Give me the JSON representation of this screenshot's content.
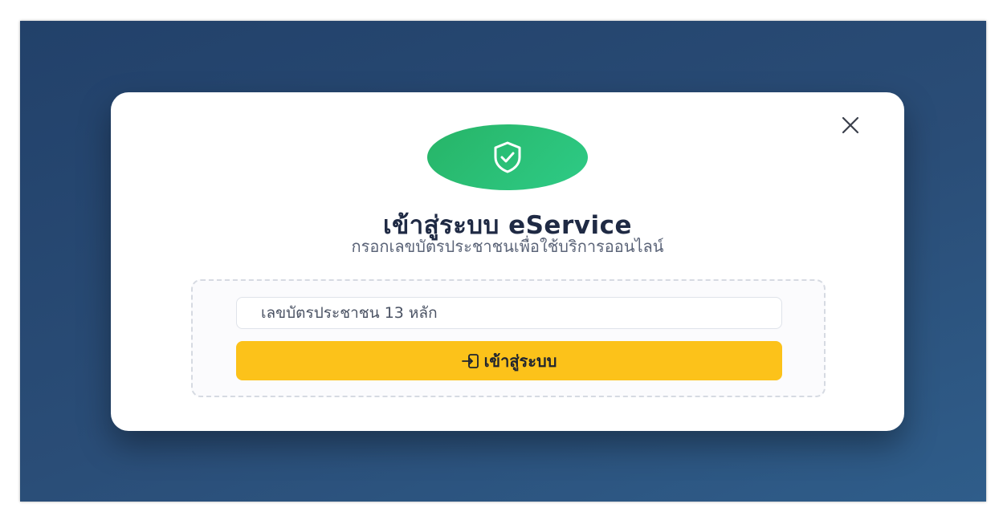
{
  "modal": {
    "title": "เข้าสู่ระบบ eService",
    "subtitle": "กรอกเลขบัตรประชาชนเพื่อใช้บริการออนไลน์",
    "close_icon": "close-icon",
    "badge_icon": "shield-check-icon"
  },
  "form": {
    "id_placeholder": "เลขบัตรประชาชน 13 หลัก",
    "id_value": "",
    "login_label": "เข้าสู่ระบบ",
    "login_icon": "login-icon"
  },
  "colors": {
    "background": "#2a4d77",
    "badge": "#2ecb86",
    "button": "#fcc21a",
    "title": "#1f2a44"
  }
}
